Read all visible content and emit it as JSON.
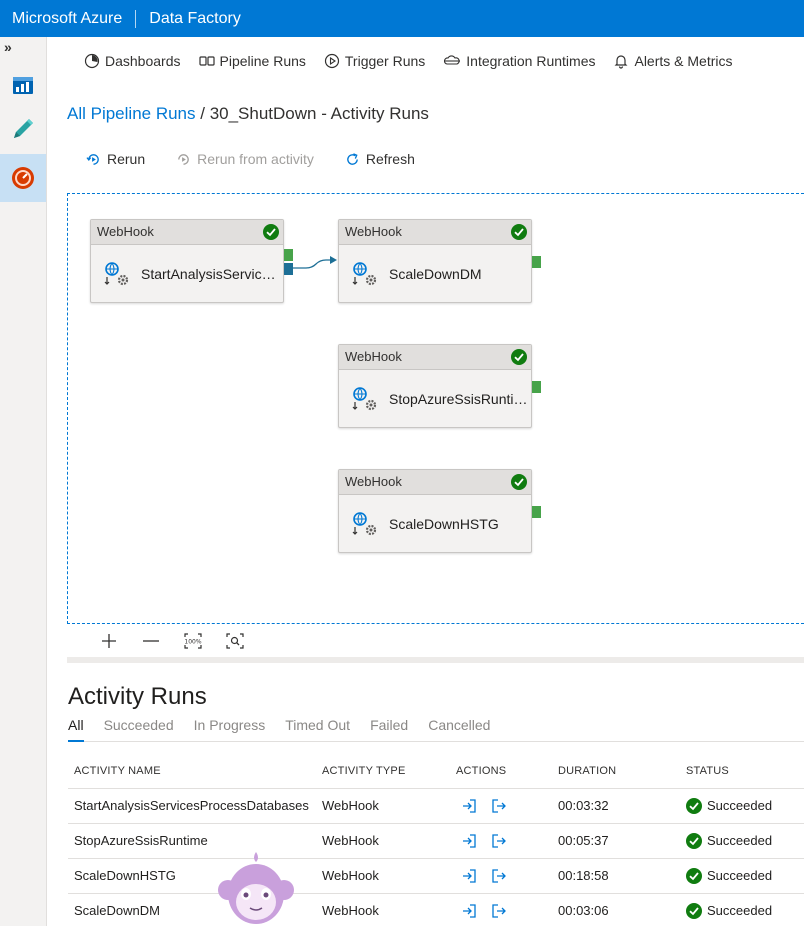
{
  "topbar": {
    "brand": "Microsoft Azure",
    "product": "Data Factory"
  },
  "rail": {
    "expand": "»",
    "items": [
      "dashboard-icon",
      "author-pencil-icon",
      "monitor-icon"
    ]
  },
  "nav": {
    "tabs": [
      {
        "label": "Dashboards",
        "icon": "dashboard-gauge-icon"
      },
      {
        "label": "Pipeline Runs",
        "icon": "pipeline-icon"
      },
      {
        "label": "Trigger Runs",
        "icon": "play-circle-icon"
      },
      {
        "label": "Integration Runtimes",
        "icon": "cloud-link-icon"
      },
      {
        "label": "Alerts & Metrics",
        "icon": "bell-icon"
      }
    ]
  },
  "breadcrumb": {
    "link": "All Pipeline Runs",
    "separator": " / ",
    "current": "30_ShutDown - Activity Runs"
  },
  "toolbar": {
    "rerun": "Rerun",
    "rerun_from": "Rerun from activity",
    "refresh": "Refresh"
  },
  "canvas": {
    "nodes": [
      {
        "type": "WebHook",
        "name": "StartAnalysisServicesP...",
        "status": "succeeded"
      },
      {
        "type": "WebHook",
        "name": "ScaleDownDM",
        "status": "succeeded"
      },
      {
        "type": "WebHook",
        "name": "StopAzureSsisRuntime...",
        "status": "succeeded"
      },
      {
        "type": "WebHook",
        "name": "ScaleDownHSTG",
        "status": "succeeded"
      }
    ],
    "zoom": [
      "zoom-in-icon",
      "zoom-out-icon",
      "zoom-100-icon",
      "zoom-fit-icon"
    ]
  },
  "runs": {
    "title": "Activity Runs",
    "filters": [
      "All",
      "Succeeded",
      "In Progress",
      "Timed Out",
      "Failed",
      "Cancelled"
    ],
    "columns": [
      "ACTIVITY NAME",
      "ACTIVITY TYPE",
      "ACTIONS",
      "DURATION",
      "STATUS"
    ],
    "rows": [
      {
        "name": "StartAnalysisServicesProcessDatabases",
        "type": "WebHook",
        "duration": "00:03:32",
        "status": "Succeeded"
      },
      {
        "name": "StopAzureSsisRuntime",
        "type": "WebHook",
        "duration": "00:05:37",
        "status": "Succeeded"
      },
      {
        "name": "ScaleDownHSTG",
        "type": "WebHook",
        "duration": "00:18:58",
        "status": "Succeeded"
      },
      {
        "name": "ScaleDownDM",
        "type": "WebHook",
        "duration": "00:03:06",
        "status": "Succeeded"
      }
    ]
  },
  "colors": {
    "accent": "#0078d4",
    "success": "#107c10",
    "port_green": "#47a34a",
    "port_blue": "#1d6f96"
  }
}
